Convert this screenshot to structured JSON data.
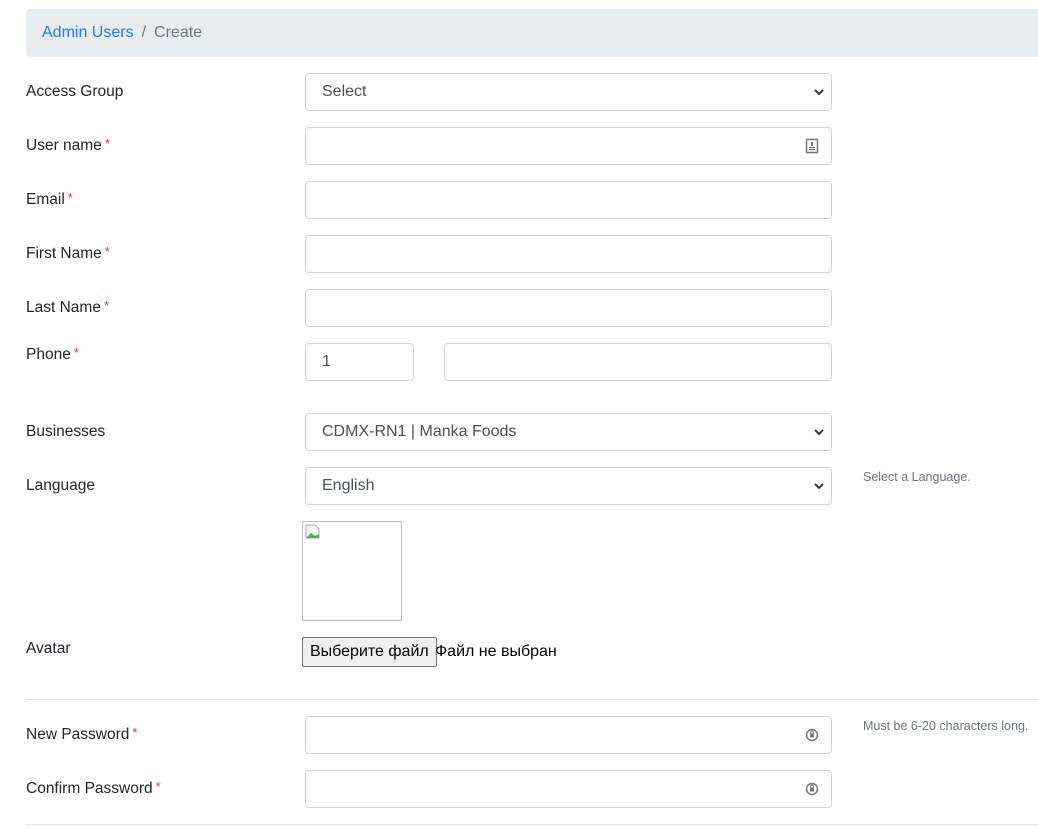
{
  "breadcrumb": {
    "parent": "Admin Users",
    "separator": "/",
    "current": "Create"
  },
  "form": {
    "access_group": {
      "label": "Access Group",
      "value": "Select"
    },
    "username": {
      "label": "User name",
      "required_mark": "*",
      "value": ""
    },
    "email": {
      "label": "Email",
      "required_mark": "*",
      "value": ""
    },
    "first_name": {
      "label": "First Name",
      "required_mark": "*",
      "value": ""
    },
    "last_name": {
      "label": "Last Name",
      "required_mark": "*",
      "value": ""
    },
    "phone": {
      "label": "Phone",
      "required_mark": "*",
      "country_code": "1",
      "number": ""
    },
    "businesses": {
      "label": "Businesses",
      "value": "CDMX-RN1 | Manka Foods"
    },
    "language": {
      "label": "Language",
      "value": "English",
      "help": "Select a Language."
    },
    "avatar": {
      "label": "Avatar",
      "button_label": "Выберите файл",
      "status": "Файл не выбран"
    },
    "new_password": {
      "label": "New Password",
      "required_mark": "*",
      "value": "",
      "help": "Must be 6-20 characters long."
    },
    "confirm_password": {
      "label": "Confirm Password",
      "required_mark": "*",
      "value": ""
    }
  },
  "colors": {
    "link": "#1f7bea",
    "required": "#e3342f",
    "breadcrumb_bg": "#e9ecef"
  }
}
